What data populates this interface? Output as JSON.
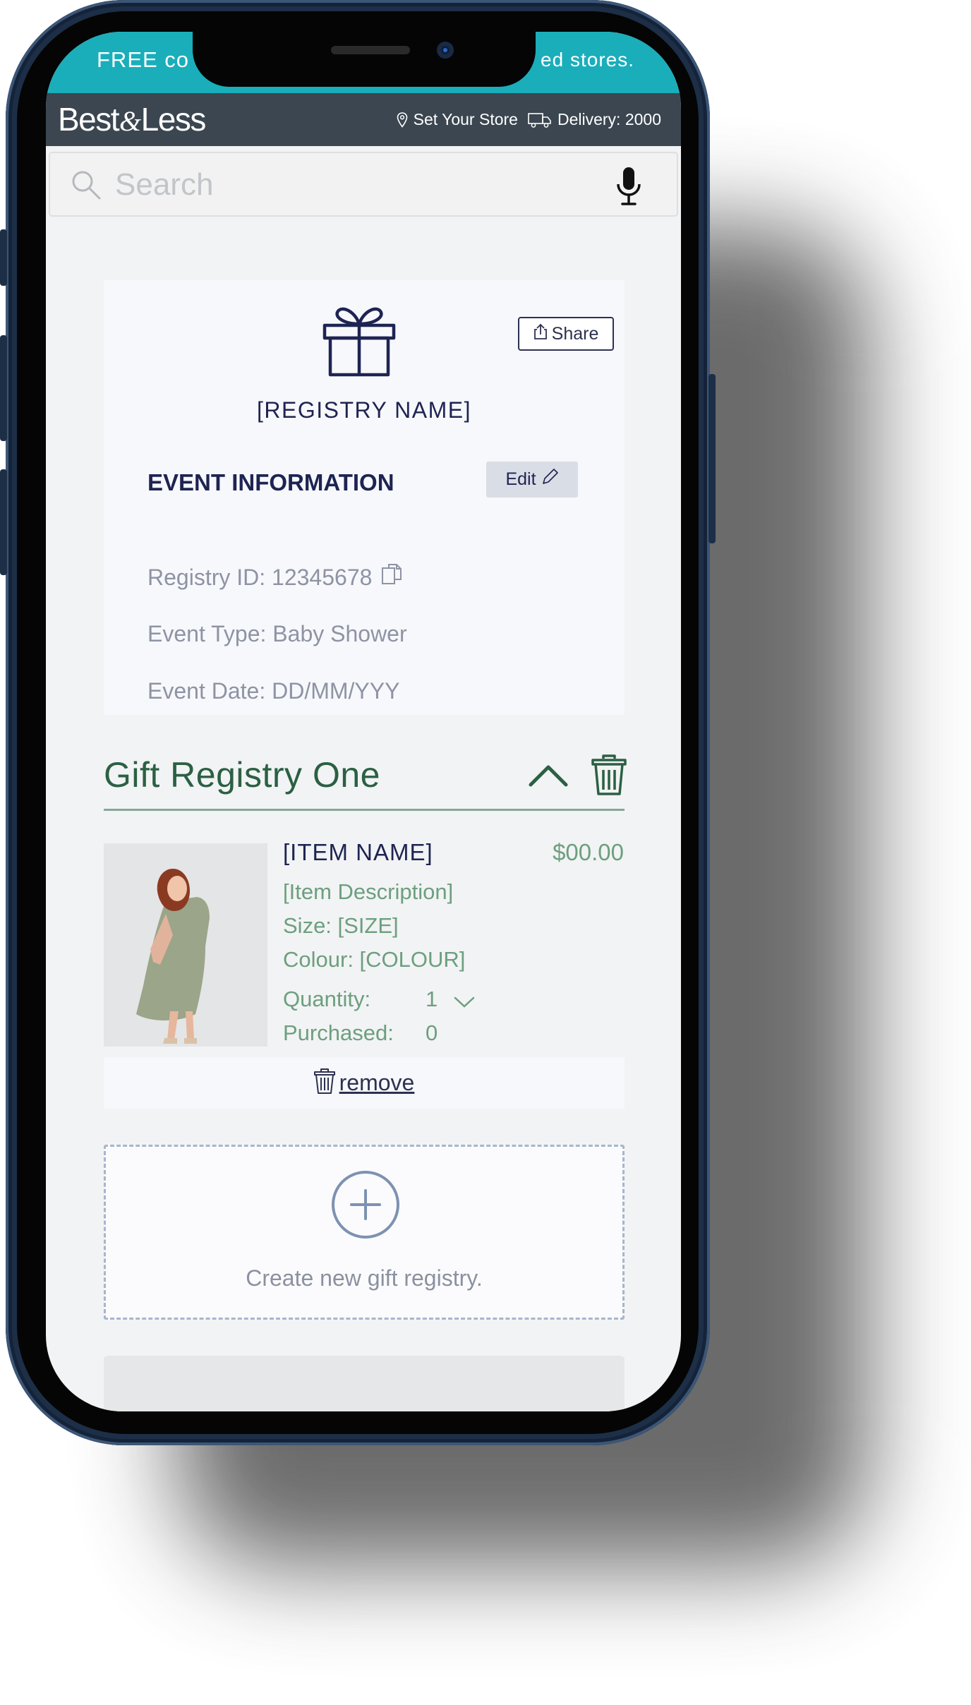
{
  "promo": {
    "left_text": "FREE co",
    "right_text": "ed stores."
  },
  "header": {
    "logo": {
      "part1": "Best",
      "amp": "&",
      "part2": "Less"
    },
    "set_store": "Set Your Store",
    "delivery": "Delivery: 2000"
  },
  "search": {
    "placeholder": "Search"
  },
  "registry_card": {
    "share_label": "Share",
    "registry_name": "[REGISTRY NAME]",
    "event_heading": "EVENT INFORMATION",
    "edit_label": "Edit",
    "registry_id": "Registry ID: 12345678",
    "event_type": "Event Type: Baby Shower",
    "event_date": "Event Date: DD/MM/YYY"
  },
  "gift_registry": {
    "title": "Gift Registry One",
    "item": {
      "name": "[ITEM NAME]",
      "price": "$00.00",
      "description": "[Item Description]",
      "size": "Size: [SIZE]",
      "colour": "Colour: [COLOUR]",
      "quantity_label": "Quantity:",
      "quantity_value": "1",
      "purchased_label": "Purchased:",
      "purchased_value": "0"
    },
    "remove_label": "remove"
  },
  "create_registry": {
    "label": "Create new gift registry."
  },
  "colors": {
    "promo_bar": "#19aeba",
    "header_bar": "#3b4650",
    "navy_text": "#1e2452",
    "green_accent": "#2b6043",
    "green_text": "#6c9f7f"
  },
  "icons": [
    "search-icon",
    "mic-icon",
    "location-pin-icon",
    "delivery-truck-icon",
    "gift-icon",
    "share-icon",
    "pencil-icon",
    "copy-icon",
    "chevron-up-icon",
    "trash-icon",
    "chevron-down-icon",
    "plus-circle-icon"
  ]
}
